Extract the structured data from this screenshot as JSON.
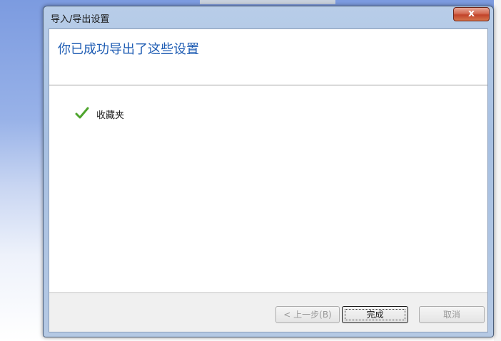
{
  "window": {
    "title": "导入/导出设置",
    "close_label": "x"
  },
  "header": {
    "title": "你已成功导出了这些设置"
  },
  "content": {
    "items": [
      {
        "label": "收藏夹",
        "icon": "check-icon",
        "status": "success"
      }
    ]
  },
  "footer": {
    "back_label": "< 上一步(B)",
    "finish_label": "完成",
    "cancel_label": "取消"
  },
  "colors": {
    "header_text": "#1e5cb3",
    "check": "#4fa52e",
    "close_button": "#c2432a"
  }
}
